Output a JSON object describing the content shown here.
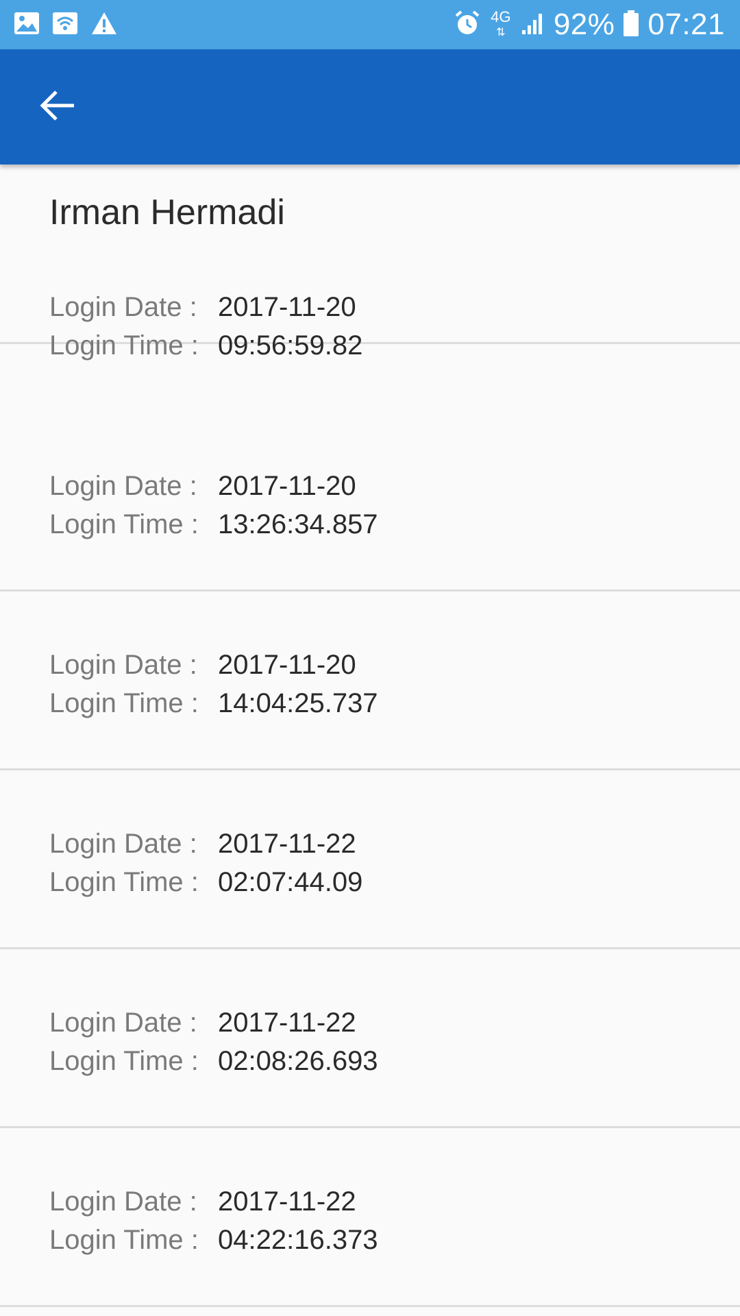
{
  "status_bar": {
    "battery": "92%",
    "time": "07:21",
    "network": "4G",
    "icons": [
      "image-icon",
      "wifi-icon",
      "warning-icon",
      "alarm-icon",
      "signal-icon",
      "battery-icon"
    ]
  },
  "app_bar": {
    "back_icon": "arrow-left-icon",
    "color": "#1565c0"
  },
  "user": {
    "name": "Irman Hermadi"
  },
  "labels": {
    "date": "Login Date :",
    "time": "Login Time :"
  },
  "entries": [
    {
      "date": "2017-11-20",
      "time": "09:56:59.82"
    },
    {
      "date": "2017-11-20",
      "time": "13:26:34.857"
    },
    {
      "date": "2017-11-20",
      "time": "14:04:25.737"
    },
    {
      "date": "2017-11-22",
      "time": "02:07:44.09"
    },
    {
      "date": "2017-11-22",
      "time": "02:08:26.693"
    },
    {
      "date": "2017-11-22",
      "time": "04:22:16.373"
    }
  ]
}
